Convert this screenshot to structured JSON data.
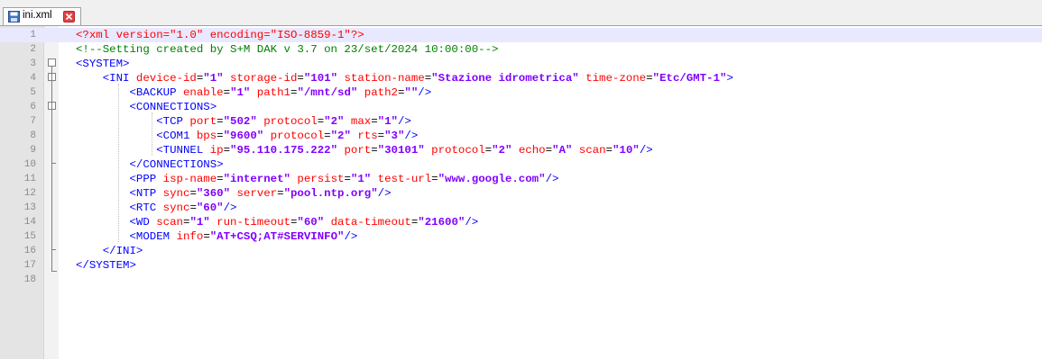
{
  "colors": {
    "tag": "#0000ff",
    "attribute": "#ff0000",
    "value": "#8000ff",
    "comment": "#008000",
    "current_line": "#e8e8ff"
  },
  "tab": {
    "label": "ini.xml",
    "icon": "save-icon",
    "close_icon": "close-icon"
  },
  "editor": {
    "lines": [
      {
        "num": "1",
        "indent": "",
        "tokens": [
          [
            "pi",
            "<?xml version=\"1.0\" encoding=\"ISO-8859-1\"?>"
          ]
        ]
      },
      {
        "num": "2",
        "indent": "",
        "tokens": [
          [
            "cm",
            "<!--Setting created by S+M DAK v 3.7 on 23/set/2024 10:00:00-->"
          ]
        ]
      },
      {
        "num": "3",
        "indent": "",
        "tokens": [
          [
            "tg",
            "<SYSTEM>"
          ]
        ]
      },
      {
        "num": "4",
        "indent": "    ",
        "tokens": [
          [
            "tg",
            "<INI"
          ],
          [
            "at",
            " device-id"
          ],
          [
            "eq",
            "="
          ],
          [
            "vl",
            "\"1\""
          ],
          [
            "at",
            " storage-id"
          ],
          [
            "eq",
            "="
          ],
          [
            "vl",
            "\"101\""
          ],
          [
            "at",
            " station-name"
          ],
          [
            "eq",
            "="
          ],
          [
            "vl",
            "\"Stazione idrometrica\""
          ],
          [
            "at",
            " time-zone"
          ],
          [
            "eq",
            "="
          ],
          [
            "vl",
            "\"Etc/GMT-1\""
          ],
          [
            "tg",
            ">"
          ]
        ]
      },
      {
        "num": "5",
        "indent": "        ",
        "tokens": [
          [
            "tg",
            "<BACKUP"
          ],
          [
            "at",
            " enable"
          ],
          [
            "eq",
            "="
          ],
          [
            "vl",
            "\"1\""
          ],
          [
            "at",
            " path1"
          ],
          [
            "eq",
            "="
          ],
          [
            "vl",
            "\"/mnt/sd\""
          ],
          [
            "at",
            " path2"
          ],
          [
            "eq",
            "="
          ],
          [
            "vl",
            "\"\""
          ],
          [
            "tg",
            "/>"
          ]
        ]
      },
      {
        "num": "6",
        "indent": "        ",
        "tokens": [
          [
            "tg",
            "<CONNECTIONS>"
          ]
        ]
      },
      {
        "num": "7",
        "indent": "            ",
        "tokens": [
          [
            "tg",
            "<TCP"
          ],
          [
            "at",
            " port"
          ],
          [
            "eq",
            "="
          ],
          [
            "vl",
            "\"502\""
          ],
          [
            "at",
            " protocol"
          ],
          [
            "eq",
            "="
          ],
          [
            "vl",
            "\"2\""
          ],
          [
            "at",
            " max"
          ],
          [
            "eq",
            "="
          ],
          [
            "vl",
            "\"1\""
          ],
          [
            "tg",
            "/>"
          ]
        ]
      },
      {
        "num": "8",
        "indent": "            ",
        "tokens": [
          [
            "tg",
            "<COM1"
          ],
          [
            "at",
            " bps"
          ],
          [
            "eq",
            "="
          ],
          [
            "vl",
            "\"9600\""
          ],
          [
            "at",
            " protocol"
          ],
          [
            "eq",
            "="
          ],
          [
            "vl",
            "\"2\""
          ],
          [
            "at",
            " rts"
          ],
          [
            "eq",
            "="
          ],
          [
            "vl",
            "\"3\""
          ],
          [
            "tg",
            "/>"
          ]
        ]
      },
      {
        "num": "9",
        "indent": "            ",
        "tokens": [
          [
            "tg",
            "<TUNNEL"
          ],
          [
            "at",
            " ip"
          ],
          [
            "eq",
            "="
          ],
          [
            "vl",
            "\"95.110.175.222\""
          ],
          [
            "at",
            " port"
          ],
          [
            "eq",
            "="
          ],
          [
            "vl",
            "\"30101\""
          ],
          [
            "at",
            " protocol"
          ],
          [
            "eq",
            "="
          ],
          [
            "vl",
            "\"2\""
          ],
          [
            "at",
            " echo"
          ],
          [
            "eq",
            "="
          ],
          [
            "vl",
            "\"A\""
          ],
          [
            "at",
            " scan"
          ],
          [
            "eq",
            "="
          ],
          [
            "vl",
            "\"10\""
          ],
          [
            "tg",
            "/>"
          ]
        ]
      },
      {
        "num": "10",
        "indent": "        ",
        "tokens": [
          [
            "tg",
            "</CONNECTIONS>"
          ]
        ]
      },
      {
        "num": "11",
        "indent": "        ",
        "tokens": [
          [
            "tg",
            "<PPP"
          ],
          [
            "at",
            " isp-name"
          ],
          [
            "eq",
            "="
          ],
          [
            "vl",
            "\"internet\""
          ],
          [
            "at",
            " persist"
          ],
          [
            "eq",
            "="
          ],
          [
            "vl",
            "\"1\""
          ],
          [
            "at",
            " test-url"
          ],
          [
            "eq",
            "="
          ],
          [
            "vl",
            "\"www.google.com\""
          ],
          [
            "tg",
            "/>"
          ]
        ]
      },
      {
        "num": "12",
        "indent": "        ",
        "tokens": [
          [
            "tg",
            "<NTP"
          ],
          [
            "at",
            " sync"
          ],
          [
            "eq",
            "="
          ],
          [
            "vl",
            "\"360\""
          ],
          [
            "at",
            " server"
          ],
          [
            "eq",
            "="
          ],
          [
            "vl",
            "\"pool.ntp.org\""
          ],
          [
            "tg",
            "/>"
          ]
        ]
      },
      {
        "num": "13",
        "indent": "        ",
        "tokens": [
          [
            "tg",
            "<RTC"
          ],
          [
            "at",
            " sync"
          ],
          [
            "eq",
            "="
          ],
          [
            "vl",
            "\"60\""
          ],
          [
            "tg",
            "/>"
          ]
        ]
      },
      {
        "num": "14",
        "indent": "        ",
        "tokens": [
          [
            "tg",
            "<WD"
          ],
          [
            "at",
            " scan"
          ],
          [
            "eq",
            "="
          ],
          [
            "vl",
            "\"1\""
          ],
          [
            "at",
            " run-timeout"
          ],
          [
            "eq",
            "="
          ],
          [
            "vl",
            "\"60\""
          ],
          [
            "at",
            " data-timeout"
          ],
          [
            "eq",
            "="
          ],
          [
            "vl",
            "\"21600\""
          ],
          [
            "tg",
            "/>"
          ]
        ]
      },
      {
        "num": "15",
        "indent": "        ",
        "tokens": [
          [
            "tg",
            "<MODEM"
          ],
          [
            "at",
            " info"
          ],
          [
            "eq",
            "="
          ],
          [
            "vl",
            "\"AT+CSQ;AT#SERVINFO\""
          ],
          [
            "tg",
            "/>"
          ]
        ]
      },
      {
        "num": "16",
        "indent": "    ",
        "tokens": [
          [
            "tg",
            "</INI>"
          ]
        ]
      },
      {
        "num": "17",
        "indent": "",
        "tokens": [
          [
            "tg",
            "</SYSTEM>"
          ]
        ]
      },
      {
        "num": "18",
        "indent": "",
        "tokens": []
      }
    ]
  }
}
